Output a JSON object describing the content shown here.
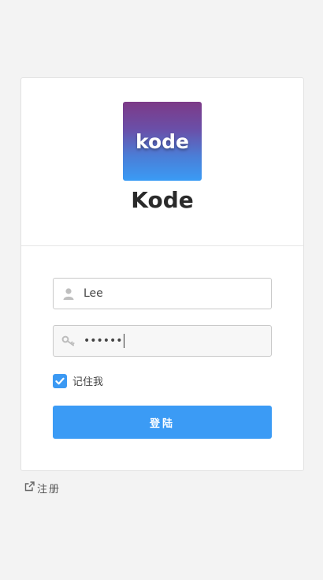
{
  "logo": {
    "text": "kode"
  },
  "brand": {
    "title": "Kode"
  },
  "form": {
    "username": {
      "value": "Lee",
      "icon": "user-icon"
    },
    "password": {
      "value": "••••••",
      "icon": "key-icon"
    },
    "remember": {
      "label": "记住我",
      "checked": true
    },
    "submit_label": "登陆"
  },
  "footer": {
    "register_label": "注册",
    "icon": "external-link-icon"
  },
  "colors": {
    "accent": "#3b9bf5",
    "logo_top": "#7d3a87",
    "logo_bottom": "#3a9bf5"
  }
}
